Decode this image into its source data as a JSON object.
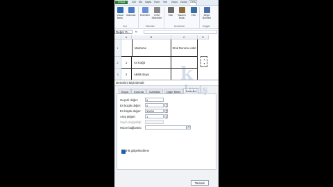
{
  "ribbon": {
    "tabs": [
      "Dosya",
      "Giri",
      "Ekl",
      "Sayfa",
      "Form",
      "Veri",
      "Gözd",
      "Görün",
      "Geliş"
    ],
    "active_tab": "Geliş",
    "buttons": [
      {
        "label": "Visual Basic",
        "icon": "visual-basic-icon",
        "color": "#2e6db4"
      },
      {
        "label": "Makrolar",
        "icon": "macros-icon",
        "color": "#4a7bc4"
      },
      {
        "label": "Eklentiler",
        "icon": "addins-icon",
        "color": "#6b8fd6"
      },
      {
        "label": "COM Eklentileri",
        "icon": "com-addins-icon",
        "color": "#888"
      },
      {
        "label": "Ekle",
        "icon": "insert-controls-icon",
        "color": "#6b6b6b"
      },
      {
        "label": "Tasarım Modu",
        "icon": "design-mode-icon",
        "color": "#8a6f3a"
      },
      {
        "label": "XML",
        "icon": "xml-icon",
        "color": "#3a6e9e"
      },
      {
        "label": "Belge Bölmesi",
        "icon": "document-panel-icon",
        "color": "#4f6fa8"
      }
    ],
    "groups": [
      "Kod",
      "Eklentiler",
      "Denetimler",
      "Değiştir"
    ]
  },
  "namebox": {
    "value": "Değer D..."
  },
  "fx_label": "fx",
  "grid": {
    "columns": [
      "A",
      "B",
      "C",
      "D"
    ],
    "header_row": {
      "num": "1",
      "b": "Malzeme",
      "c": "Stok Durumu Adet"
    },
    "rows": [
      {
        "num": "2",
        "a": "1",
        "b": "A4 Kağıt"
      },
      {
        "num": "3",
        "a": "2",
        "b": "Akrilik Boya"
      }
    ]
  },
  "dialog": {
    "title": "Denetimi Biçimlendir",
    "tabs": [
      "Boyut",
      "Koruma",
      "Özellikler",
      "Diğer Metin",
      "Denetim"
    ],
    "active_tab": "Denetim",
    "fields": [
      {
        "label": "Geçerli değer:",
        "value": "0",
        "enabled": true
      },
      {
        "label": "En küçük değer:",
        "value": "0",
        "enabled": true
      },
      {
        "label": "En büyük değer:",
        "value": "30000",
        "enabled": true
      },
      {
        "label": "Artış değeri:",
        "value": "1",
        "enabled": true
      },
      {
        "label": "Sayfa değişikliği:",
        "value": "",
        "enabled": false
      },
      {
        "label": "Hücre bağlantısı:",
        "value": "",
        "enabled": true
      }
    ],
    "checkbox_label": "3-B gölgelendirme",
    "ok_label": "Tamam"
  }
}
